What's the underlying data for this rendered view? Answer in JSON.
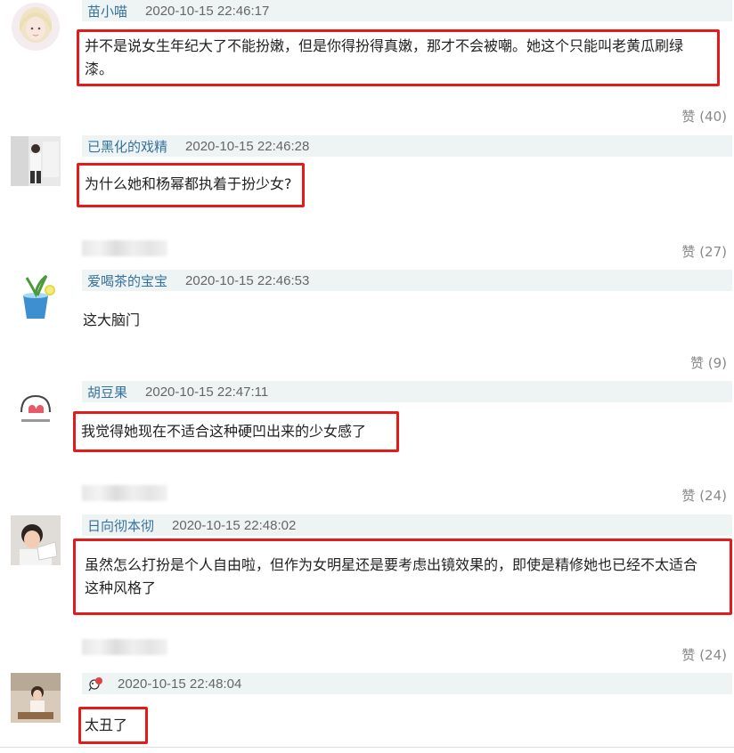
{
  "comments": [
    {
      "user": "苗小喵",
      "time": "2020-10-15 22:46:17",
      "text_line1": "并不是说女生年纪大了不能扮嫩，但是你得扮得真嫩，那才不会被嘲。她这个只能叫老黄瓜刷绿",
      "text_line2": "漆。",
      "likes_label": "赞",
      "likes": "(40)"
    },
    {
      "user": "已黑化的戏精",
      "time": "2020-10-15 22:46:28",
      "text": "为什么她和杨幂都执着于扮少女?",
      "likes_label": "赞",
      "likes": "(27)"
    },
    {
      "user": "爱喝茶的宝宝",
      "time": "2020-10-15 22:46:53",
      "text": "这大脑门",
      "likes_label": "赞",
      "likes": "(9)"
    },
    {
      "user": "胡豆果",
      "time": "2020-10-15 22:47:11",
      "text": "我觉得她现在不适合这种硬凹出来的少女感了",
      "likes_label": "赞",
      "likes": "(24)"
    },
    {
      "user": "日向彻本彻",
      "time": "2020-10-15 22:48:02",
      "text_line1": "虽然怎么打扮是个人自由啦，但作为女明星还是要考虑出镜效果的，即使是精修她也已经不太适合",
      "text_line2": "这种风格了",
      "likes_label": "赞",
      "likes": "(24)"
    },
    {
      "user": "",
      "time": "2020-10-15 22:48:04",
      "text": "太丑了"
    }
  ],
  "colors": {
    "highlight_border": "#e41b1b",
    "username": "#35729c",
    "meta_bg": "#eef3f4"
  }
}
